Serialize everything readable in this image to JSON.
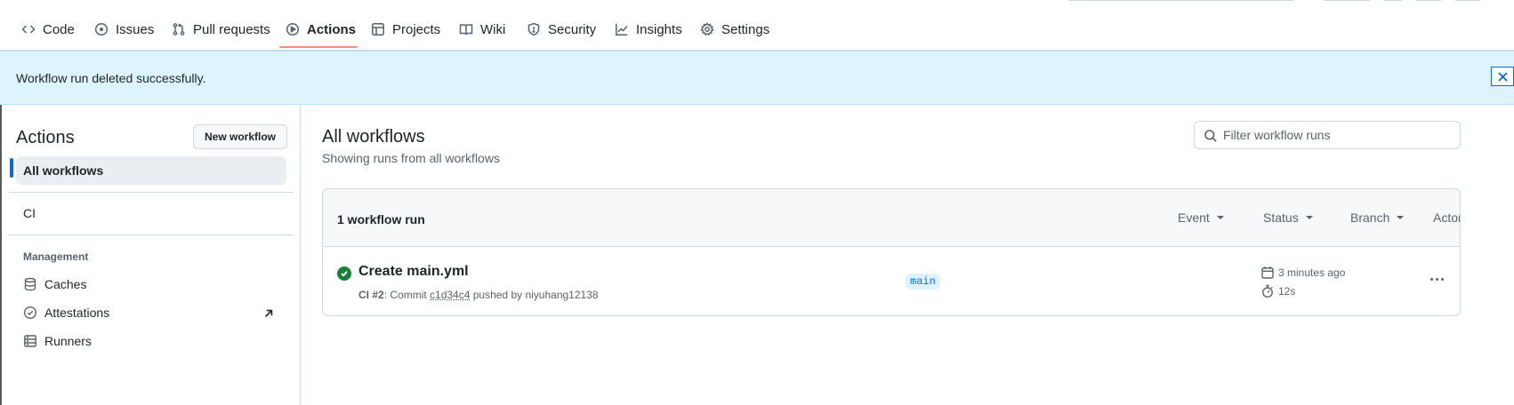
{
  "nav": {
    "items": [
      {
        "label": "Code",
        "icon": "code-icon"
      },
      {
        "label": "Issues",
        "icon": "issue-icon"
      },
      {
        "label": "Pull requests",
        "icon": "pull-request-icon"
      },
      {
        "label": "Actions",
        "icon": "play-icon",
        "active": true
      },
      {
        "label": "Projects",
        "icon": "table-icon"
      },
      {
        "label": "Wiki",
        "icon": "book-icon"
      },
      {
        "label": "Security",
        "icon": "shield-icon"
      },
      {
        "label": "Insights",
        "icon": "graph-icon"
      },
      {
        "label": "Settings",
        "icon": "gear-icon"
      }
    ],
    "accent": "#fd8c73"
  },
  "flash": {
    "message": "Workflow run deleted successfully.",
    "close_icon": "close-icon",
    "background": "#ddf4ff"
  },
  "sidebar": {
    "title": "Actions",
    "new_workflow_label": "New workflow",
    "all_workflows_label": "All workflows",
    "workflows": [
      "CI"
    ],
    "management_heading": "Management",
    "management_items": [
      {
        "label": "Caches",
        "icon": "database-icon"
      },
      {
        "label": "Attestations",
        "icon": "verified-icon",
        "external": true
      },
      {
        "label": "Runners",
        "icon": "server-icon"
      }
    ]
  },
  "main": {
    "title": "All workflows",
    "subtitle": "Showing runs from all workflows",
    "filter_placeholder": "Filter workflow runs",
    "run_count": "1 workflow run",
    "filters": [
      "Event",
      "Status",
      "Branch",
      "Actor"
    ],
    "runs": [
      {
        "title": "Create main.yml",
        "workflow": "CI #2",
        "meta_prefix": ": Commit ",
        "sha": "c1d34c4",
        "meta_suffix": " pushed by niyuhang12138",
        "branch": "main",
        "time_ago": "3 minutes ago",
        "duration": "12s",
        "status": "success",
        "status_color": "#1a7f37"
      }
    ]
  }
}
